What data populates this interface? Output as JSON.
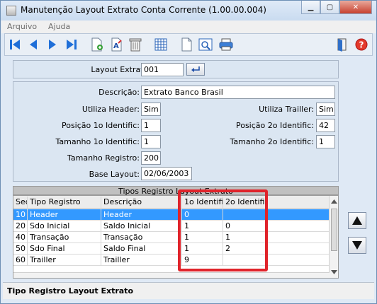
{
  "window": {
    "title": "Manutenção Layout Extrato Conta Corrente (1.00.00.004)"
  },
  "menu": {
    "items": [
      "Arquivo",
      "Ajuda"
    ]
  },
  "header_form": {
    "layout_label": "Layout Extrato:",
    "layout_value": "001"
  },
  "details": {
    "descricao_label": "Descrição:",
    "descricao_value": "Extrato Banco Brasil",
    "utiliza_header_label": "Utiliza Header:",
    "utiliza_header_value": "Sim",
    "utiliza_trailler_label": "Utiliza Trailler:",
    "utiliza_trailler_value": "Sim",
    "pos1_label": "Posição 1o Identific:",
    "pos1_value": "1",
    "pos2_label": "Posição 2o Identific:",
    "pos2_value": "42",
    "tam1_label": "Tamanho 1o Identific:",
    "tam1_value": "1",
    "tam2_label": "Tamanho 2o Identific:",
    "tam2_value": "1",
    "tam_reg_label": "Tamanho Registro:",
    "tam_reg_value": "200",
    "base_label": "Base Layout:",
    "base_value": "02/06/2003"
  },
  "grid": {
    "caption": "Tipos Registro Layout Extrato",
    "columns": [
      "Seq",
      "Tipo Registro",
      "Descrição",
      "1o Identific",
      "2o Identific"
    ],
    "rows": [
      {
        "seq": "10",
        "tipo": "Header",
        "desc": "Header",
        "id1": "0",
        "id2": ""
      },
      {
        "seq": "20",
        "tipo": "Sdo Inicial",
        "desc": "Saldo Inicial",
        "id1": "1",
        "id2": "0"
      },
      {
        "seq": "40",
        "tipo": "Transação",
        "desc": "Transação",
        "id1": "1",
        "id2": "1"
      },
      {
        "seq": "50",
        "tipo": "Sdo Final",
        "desc": "Saldo Final",
        "id1": "1",
        "id2": "2"
      },
      {
        "seq": "60",
        "tipo": "Trailler",
        "desc": "Trailler",
        "id1": "9",
        "id2": ""
      }
    ],
    "selected_row": 0
  },
  "statusbar": {
    "text": "Tipo Registro Layout Extrato"
  },
  "colors": {
    "selection": "#3399ff",
    "highlight_border": "#e0232a",
    "toolbar_icon_blue": "#1f6fd8"
  }
}
